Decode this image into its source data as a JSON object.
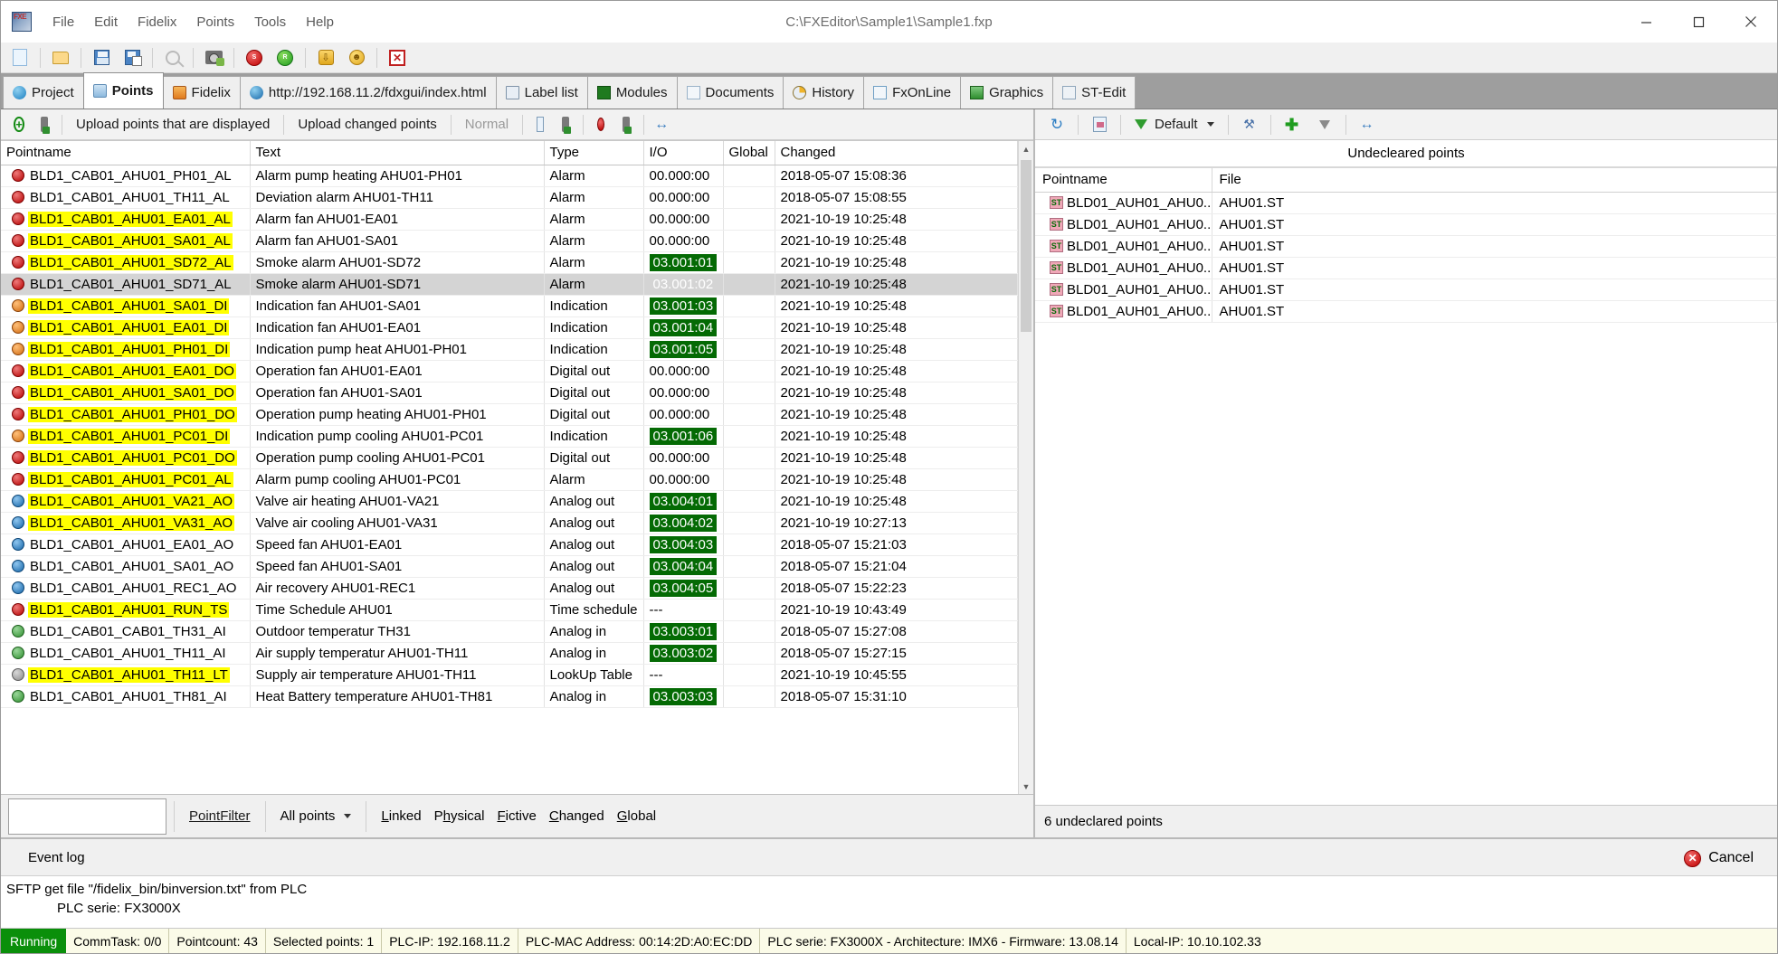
{
  "window": {
    "title": "C:\\FXEditor\\Sample1\\Sample1.fxp",
    "minimize_label": "Minimize",
    "maximize_label": "Maximize",
    "close_label": "Close"
  },
  "menu": [
    "File",
    "Edit",
    "Fidelix",
    "Points",
    "Tools",
    "Help"
  ],
  "toolbar": [
    {
      "name": "new-file-icon",
      "icon": "doc"
    },
    {
      "name": "open-file-icon",
      "icon": "folder"
    },
    {
      "name": "save-icon",
      "icon": "save"
    },
    {
      "name": "save-as-icon",
      "icon": "saveall"
    },
    {
      "name": "find-icon",
      "icon": "search"
    },
    {
      "name": "snapshot-icon",
      "icon": "cam"
    },
    {
      "name": "stop-icon",
      "icon": "stop"
    },
    {
      "name": "start-icon",
      "icon": "run"
    },
    {
      "name": "upload-icon",
      "icon": "up"
    },
    {
      "name": "download-icon",
      "icon": "smile"
    },
    {
      "name": "close-project-icon",
      "icon": "x"
    }
  ],
  "tabs": [
    {
      "label": "Project",
      "icon": "ti-info",
      "active": false
    },
    {
      "label": "Points",
      "icon": "ti-db",
      "active": true
    },
    {
      "label": "Fidelix",
      "icon": "ti-orange",
      "active": false
    },
    {
      "label": "http://192.168.11.2/fdxgui/index.html",
      "icon": "ti-globe",
      "active": false
    },
    {
      "label": "Label list",
      "icon": "ti-label",
      "active": false
    },
    {
      "label": "Modules",
      "icon": "ti-mod",
      "active": false
    },
    {
      "label": "Documents",
      "icon": "ti-doc",
      "active": false
    },
    {
      "label": "History",
      "icon": "ti-hist",
      "active": false
    },
    {
      "label": "FxOnLine",
      "icon": "ti-fx",
      "active": false
    },
    {
      "label": "Graphics",
      "icon": "ti-graph",
      "active": false
    },
    {
      "label": "ST-Edit",
      "icon": "ti-st",
      "active": false
    }
  ],
  "points_toolbar": {
    "add_point": "add-point-icon",
    "import_points": "import-points-icon",
    "upload_displayed": "Upload points that are displayed",
    "upload_changed": "Upload changed points",
    "normal": "Normal",
    "page_icon": "page-icon",
    "export_icon": "export-icon",
    "stop_icon": "stop-icon",
    "download_icon": "download-icon",
    "autofit_icon": "autofit-columns-icon"
  },
  "table": {
    "columns": [
      "Pointname",
      "Text",
      "Type",
      "I/O",
      "Global",
      "Changed"
    ],
    "rows": [
      {
        "icon": "pi-al",
        "name": "BLD1_CAB01_AHU01_PH01_AL",
        "hl": false,
        "text": "Alarm pump heating AHU01-PH01",
        "type": "Alarm",
        "io": "00.000:00",
        "io_badge": false,
        "global": "",
        "changed": "2018-05-07 15:08:36",
        "selected": false
      },
      {
        "icon": "pi-al",
        "name": "BLD1_CAB01_AHU01_TH11_AL",
        "hl": false,
        "text": "Deviation alarm AHU01-TH11",
        "type": "Alarm",
        "io": "00.000:00",
        "io_badge": false,
        "global": "",
        "changed": "2018-05-07 15:08:55",
        "selected": false
      },
      {
        "icon": "pi-al",
        "name": "BLD1_CAB01_AHU01_EA01_AL",
        "hl": true,
        "text": "Alarm fan AHU01-EA01",
        "type": "Alarm",
        "io": "00.000:00",
        "io_badge": false,
        "global": "",
        "changed": "2021-10-19 10:25:48",
        "selected": false
      },
      {
        "icon": "pi-al",
        "name": "BLD1_CAB01_AHU01_SA01_AL",
        "hl": true,
        "text": "Alarm fan AHU01-SA01",
        "type": "Alarm",
        "io": "00.000:00",
        "io_badge": false,
        "global": "",
        "changed": "2021-10-19 10:25:48",
        "selected": false
      },
      {
        "icon": "pi-al",
        "name": "BLD1_CAB01_AHU01_SD72_AL",
        "hl": true,
        "text": "Smoke alarm AHU01-SD72",
        "type": "Alarm",
        "io": "03.001:01",
        "io_badge": true,
        "global": "",
        "changed": "2021-10-19 10:25:48",
        "selected": false
      },
      {
        "icon": "pi-al",
        "name": "BLD1_CAB01_AHU01_SD71_AL",
        "hl": false,
        "text": "Smoke alarm AHU01-SD71",
        "type": "Alarm",
        "io": "03.001:02",
        "io_badge": true,
        "global": "",
        "changed": "2021-10-19 10:25:48",
        "selected": true
      },
      {
        "icon": "pi-di",
        "name": "BLD1_CAB01_AHU01_SA01_DI",
        "hl": true,
        "text": "Indication fan AHU01-SA01",
        "type": "Indication",
        "io": "03.001:03",
        "io_badge": true,
        "global": "",
        "changed": "2021-10-19 10:25:48",
        "selected": false
      },
      {
        "icon": "pi-di",
        "name": "BLD1_CAB01_AHU01_EA01_DI",
        "hl": true,
        "text": "Indication fan AHU01-EA01",
        "type": "Indication",
        "io": "03.001:04",
        "io_badge": true,
        "global": "",
        "changed": "2021-10-19 10:25:48",
        "selected": false
      },
      {
        "icon": "pi-di",
        "name": "BLD1_CAB01_AHU01_PH01_DI",
        "hl": true,
        "text": "Indication pump heat AHU01-PH01",
        "type": "Indication",
        "io": "03.001:05",
        "io_badge": true,
        "global": "",
        "changed": "2021-10-19 10:25:48",
        "selected": false
      },
      {
        "icon": "pi-do",
        "name": "BLD1_CAB01_AHU01_EA01_DO",
        "hl": true,
        "text": "Operation fan AHU01-EA01",
        "type": "Digital out",
        "io": "00.000:00",
        "io_badge": false,
        "global": "",
        "changed": "2021-10-19 10:25:48",
        "selected": false
      },
      {
        "icon": "pi-do",
        "name": "BLD1_CAB01_AHU01_SA01_DO",
        "hl": true,
        "text": "Operation fan AHU01-SA01",
        "type": "Digital out",
        "io": "00.000:00",
        "io_badge": false,
        "global": "",
        "changed": "2021-10-19 10:25:48",
        "selected": false
      },
      {
        "icon": "pi-do",
        "name": "BLD1_CAB01_AHU01_PH01_DO",
        "hl": true,
        "text": "Operation pump heating AHU01-PH01",
        "type": "Digital out",
        "io": "00.000:00",
        "io_badge": false,
        "global": "",
        "changed": "2021-10-19 10:25:48",
        "selected": false
      },
      {
        "icon": "pi-di",
        "name": "BLD1_CAB01_AHU01_PC01_DI",
        "hl": true,
        "text": "Indication pump cooling AHU01-PC01",
        "type": "Indication",
        "io": "03.001:06",
        "io_badge": true,
        "global": "",
        "changed": "2021-10-19 10:25:48",
        "selected": false
      },
      {
        "icon": "pi-do",
        "name": "BLD1_CAB01_AHU01_PC01_DO",
        "hl": true,
        "text": "Operation pump cooling AHU01-PC01",
        "type": "Digital out",
        "io": "00.000:00",
        "io_badge": false,
        "global": "",
        "changed": "2021-10-19 10:25:48",
        "selected": false
      },
      {
        "icon": "pi-al",
        "name": "BLD1_CAB01_AHU01_PC01_AL",
        "hl": true,
        "text": "Alarm pump cooling AHU01-PC01",
        "type": "Alarm",
        "io": "00.000:00",
        "io_badge": false,
        "global": "",
        "changed": "2021-10-19 10:25:48",
        "selected": false
      },
      {
        "icon": "pi-ao",
        "name": "BLD1_CAB01_AHU01_VA21_AO",
        "hl": true,
        "text": "Valve air heating AHU01-VA21",
        "type": "Analog out",
        "io": "03.004:01",
        "io_badge": true,
        "global": "",
        "changed": "2021-10-19 10:25:48",
        "selected": false
      },
      {
        "icon": "pi-ao",
        "name": "BLD1_CAB01_AHU01_VA31_AO",
        "hl": true,
        "text": "Valve air cooling AHU01-VA31",
        "type": "Analog out",
        "io": "03.004:02",
        "io_badge": true,
        "global": "",
        "changed": "2021-10-19 10:27:13",
        "selected": false
      },
      {
        "icon": "pi-ao",
        "name": "BLD1_CAB01_AHU01_EA01_AO",
        "hl": false,
        "text": "Speed fan AHU01-EA01",
        "type": "Analog out",
        "io": "03.004:03",
        "io_badge": true,
        "global": "",
        "changed": "2018-05-07 15:21:03",
        "selected": false
      },
      {
        "icon": "pi-ao",
        "name": "BLD1_CAB01_AHU01_SA01_AO",
        "hl": false,
        "text": "Speed fan AHU01-SA01",
        "type": "Analog out",
        "io": "03.004:04",
        "io_badge": true,
        "global": "",
        "changed": "2018-05-07 15:21:04",
        "selected": false
      },
      {
        "icon": "pi-ao",
        "name": "BLD1_CAB01_AHU01_REC1_AO",
        "hl": false,
        "text": "Air recovery AHU01-REC1",
        "type": "Analog out",
        "io": "03.004:05",
        "io_badge": true,
        "global": "",
        "changed": "2018-05-07 15:22:23",
        "selected": false
      },
      {
        "icon": "pi-ts",
        "name": "BLD1_CAB01_AHU01_RUN_TS",
        "hl": true,
        "text": "Time Schedule AHU01",
        "type": "Time schedule",
        "io": "---",
        "io_badge": false,
        "global": "",
        "changed": "2021-10-19 10:43:49",
        "selected": false
      },
      {
        "icon": "pi-ai",
        "name": "BLD1_CAB01_CAB01_TH31_AI",
        "hl": false,
        "text": "Outdoor temperatur TH31",
        "type": "Analog in",
        "io": "03.003:01",
        "io_badge": true,
        "global": "",
        "changed": "2018-05-07 15:27:08",
        "selected": false
      },
      {
        "icon": "pi-ai",
        "name": "BLD1_CAB01_AHU01_TH11_AI",
        "hl": false,
        "text": "Air supply temperatur AHU01-TH11",
        "type": "Analog in",
        "io": "03.003:02",
        "io_badge": true,
        "global": "",
        "changed": "2018-05-07 15:27:15",
        "selected": false
      },
      {
        "icon": "pi-lt",
        "name": "BLD1_CAB01_AHU01_TH11_LT",
        "hl": true,
        "text": "Supply air temperature AHU01-TH11",
        "type": "LookUp Table",
        "io": "---",
        "io_badge": false,
        "global": "",
        "changed": "2021-10-19 10:45:55",
        "selected": false
      },
      {
        "icon": "pi-ai",
        "name": "BLD1_CAB01_AHU01_TH81_AI",
        "hl": false,
        "text": "Heat Battery temperature AHU01-TH81",
        "type": "Analog in",
        "io": "03.003:03",
        "io_badge": true,
        "global": "",
        "changed": "2018-05-07 15:31:10",
        "selected": false
      }
    ]
  },
  "filterbar": {
    "input_value": "",
    "input_placeholder": "",
    "pointfilter_label": "PointFilter",
    "combo_value": "All points",
    "checks": [
      "Linked",
      "Physical",
      "Fictive",
      "Changed",
      "Global"
    ]
  },
  "right_panel": {
    "toolbar": {
      "refresh": "refresh-icon",
      "import": "import-icon",
      "filter_label": "Default",
      "tools": "tools-icon",
      "add": "add-icon",
      "filter2": "filter-icon",
      "resize": "resize-columns-icon"
    },
    "title": "Undecleared points",
    "columns": [
      "Pointname",
      "File"
    ],
    "rows": [
      {
        "name": "BLD01_AUH01_AHU0...",
        "file": "AHU01.ST"
      },
      {
        "name": "BLD01_AUH01_AHU0...",
        "file": "AHU01.ST"
      },
      {
        "name": "BLD01_AUH01_AHU0...",
        "file": "AHU01.ST"
      },
      {
        "name": "BLD01_AUH01_AHU0...",
        "file": "AHU01.ST"
      },
      {
        "name": "BLD01_AUH01_AHU0...",
        "file": "AHU01.ST"
      },
      {
        "name": "BLD01_AUH01_AHU0...",
        "file": "AHU01.ST"
      }
    ],
    "status": "6 undeclared points"
  },
  "event_log": {
    "title": "Event log",
    "cancel_label": "Cancel",
    "lines": [
      "SFTP get file \"/fidelix_bin/binversion.txt\" from PLC",
      "PLC serie: FX3000X"
    ]
  },
  "statusbar": {
    "running": "Running",
    "cells": [
      "CommTask: 0/0",
      "Pointcount: 43",
      "Selected points: 1",
      "PLC-IP: 192.168.11.2",
      "PLC-MAC Address: 00:14:2D:A0:EC:DD",
      "PLC serie: FX3000X - Architecture: IMX6 - Firmware: 13.08.14",
      "Local-IP: 10.10.102.33"
    ]
  },
  "colors": {
    "highlight": "#ffff00",
    "io_badge": "#046a04",
    "running": "#0a8f0a",
    "selection": "#d4d4d4",
    "statusbar_bg": "#fbfbe8"
  }
}
